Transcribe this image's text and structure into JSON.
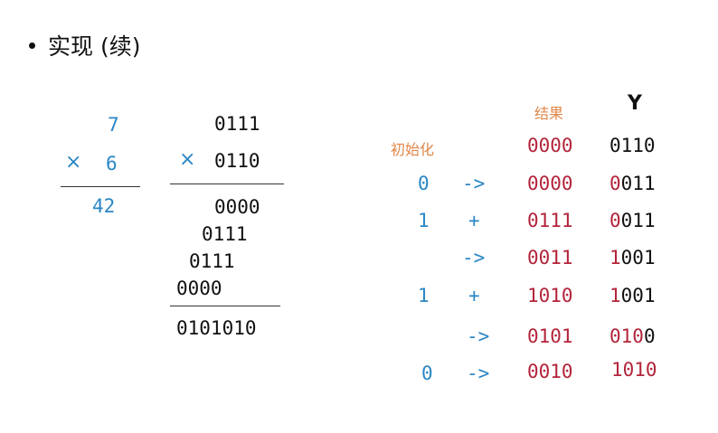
{
  "heading": {
    "text": "实现 (续)"
  },
  "decimal_mult": {
    "multiplicand": "7",
    "times_symbol": "×",
    "multiplier": "6",
    "product": "42"
  },
  "binary_mult": {
    "multiplicand": "0111",
    "times_symbol": "×",
    "multiplier": "0110",
    "partials": [
      "0000",
      "0111",
      "0111",
      "0000"
    ],
    "product": "0101010"
  },
  "table": {
    "header_result": "结果",
    "header_y": "Y",
    "init_label": "初始化",
    "rows": [
      {
        "bit": "",
        "op": "",
        "result": "0000",
        "y": "0110"
      },
      {
        "bit": "0",
        "op": "->",
        "result": "0000",
        "y_prefix": "0",
        "y_rest": "011"
      },
      {
        "bit": "1",
        "op": "+",
        "result": "0111",
        "y_prefix": "0",
        "y_rest": "011"
      },
      {
        "bit": "",
        "op": "->",
        "result": "0011",
        "y_prefix": "1",
        "y_rest": "001"
      },
      {
        "bit": "1",
        "op": "+",
        "result": "1010",
        "y_prefix": "1",
        "y_rest": "001"
      },
      {
        "bit": "",
        "op": "->",
        "result": "0101",
        "y_prefix": "010",
        "y_rest": "0"
      },
      {
        "bit": "0",
        "op": "->",
        "result": "0010",
        "y_prefix": "1010",
        "y_rest": ""
      }
    ]
  }
}
